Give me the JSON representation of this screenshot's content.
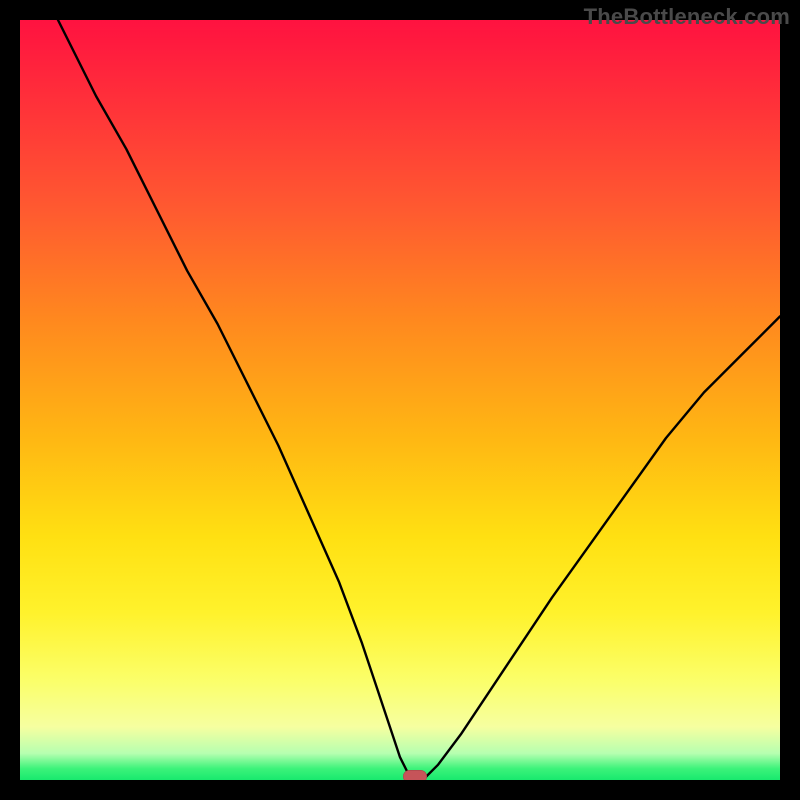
{
  "watermark": {
    "text": "TheBottleneck.com"
  },
  "chart_data": {
    "type": "line",
    "title": "",
    "xlabel": "",
    "ylabel": "",
    "xlim": [
      0,
      100
    ],
    "ylim": [
      0,
      100
    ],
    "grid": false,
    "legend": false,
    "note": "Gradient background red→yellow→green (top→bottom). Black boundary box. V-shaped black curve representing bottleneck % vs component balance; minimum near x≈52, y≈0. Small red pill marker at the minimum.",
    "series": [
      {
        "name": "bottleneck-curve",
        "x": [
          0,
          5,
          10,
          14,
          18,
          22,
          26,
          30,
          34,
          38,
          42,
          45,
          47,
          49,
          50,
          51,
          52,
          53,
          55,
          58,
          62,
          66,
          70,
          75,
          80,
          85,
          90,
          95,
          100
        ],
        "values": [
          110,
          100,
          90,
          83,
          75,
          67,
          60,
          52,
          44,
          35,
          26,
          18,
          12,
          6,
          3,
          1,
          0,
          0,
          2,
          6,
          12,
          18,
          24,
          31,
          38,
          45,
          51,
          56,
          61
        ]
      }
    ],
    "marker": {
      "x": 52,
      "y": 0
    },
    "background_gradient": {
      "direction": "vertical",
      "stops": [
        {
          "pos": 0.0,
          "color": "#ff1240"
        },
        {
          "pos": 0.4,
          "color": "#ff8a1e"
        },
        {
          "pos": 0.68,
          "color": "#ffe012"
        },
        {
          "pos": 0.93,
          "color": "#f6ffa0"
        },
        {
          "pos": 1.0,
          "color": "#18e96e"
        }
      ]
    }
  }
}
